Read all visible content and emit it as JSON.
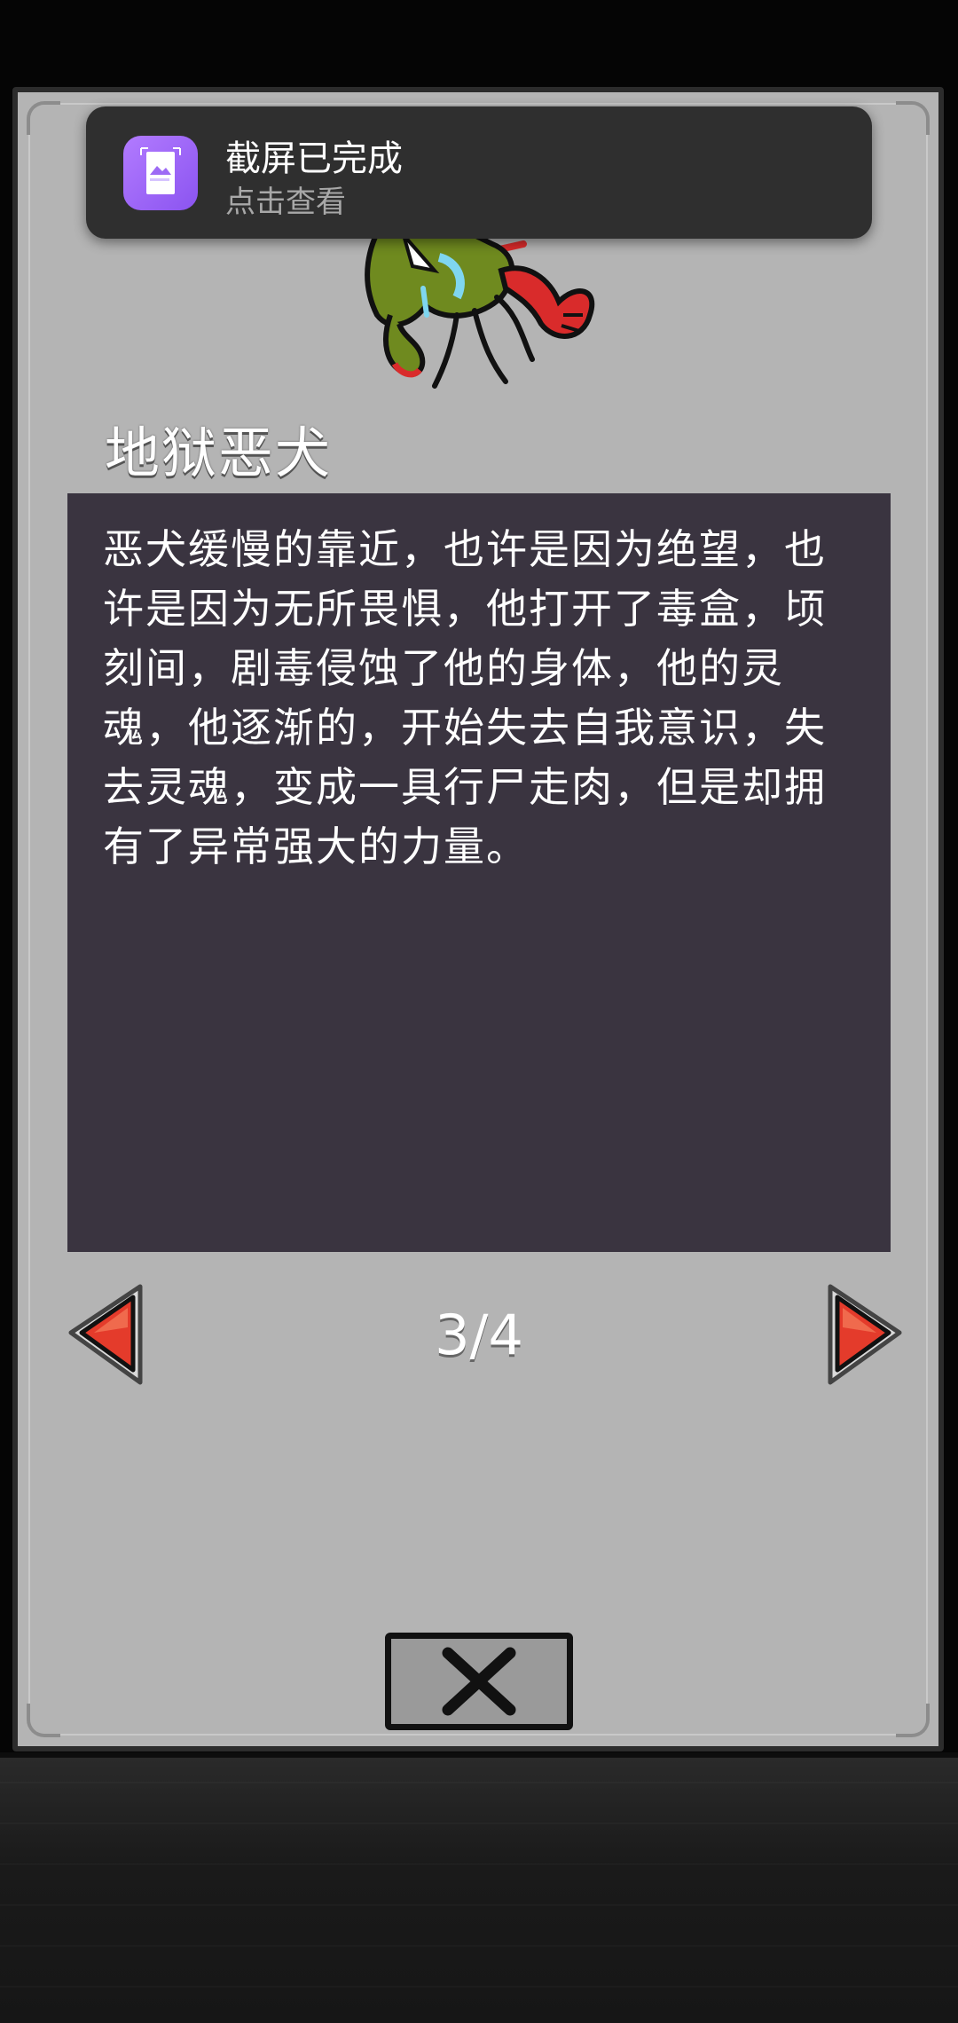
{
  "notification": {
    "title": "截屏已完成",
    "subtitle": "点击查看",
    "icon": "screenshot-gallery-icon"
  },
  "monster": {
    "name": "地狱恶犬",
    "description": "恶犬缓慢的靠近，也许是因为绝望，也许是因为无所畏惧，他打开了毒盒，顷刻间，剧毒侵蚀了他的身体，他的灵魂，他逐渐的，开始失去自我意识，失去灵魂，变成一具行尸走肉，但是却拥有了异常强大的力量。",
    "image": "hellhound-creature-illustration"
  },
  "pagination": {
    "current": 3,
    "total": 4,
    "label": "3/4",
    "prev_icon": "red-left-arrow-icon",
    "next_icon": "red-right-arrow-icon"
  },
  "close": {
    "icon": "close-x-icon"
  },
  "colors": {
    "panel": "#b4b4b4",
    "description_bg": "#3a3440",
    "arrow_red": "#e43b2b",
    "creature_green": "#6f8a1f"
  }
}
